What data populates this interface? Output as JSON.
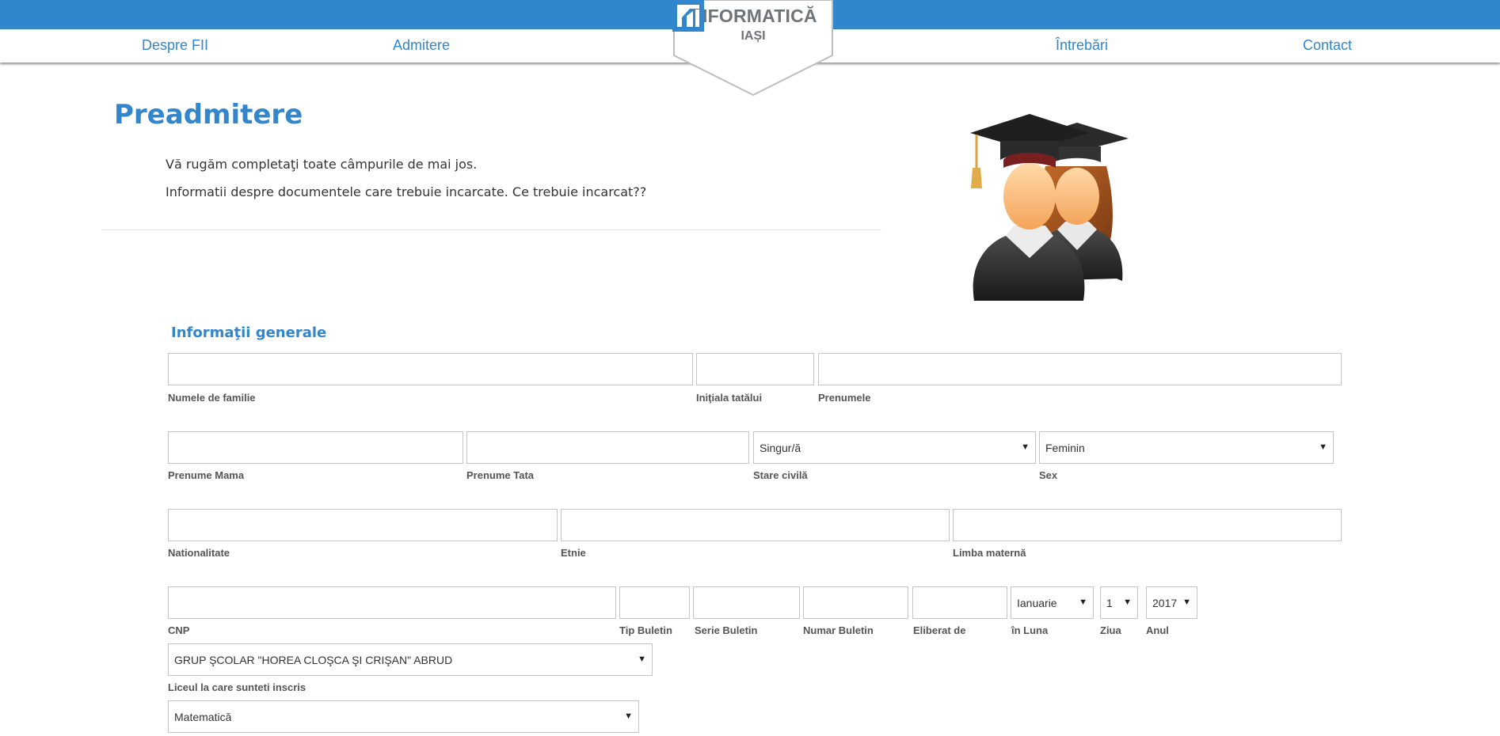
{
  "nav": {
    "items": [
      "Despre FII",
      "Admitere",
      "Întrebări",
      "Contact"
    ]
  },
  "logo": {
    "title": "INFORMATICĂ",
    "subtitle": "IAȘI"
  },
  "page": {
    "title": "Preadmitere",
    "intro_line1": "Vă rugăm completaţi toate câmpurile de mai jos.",
    "intro_line2": "Informatii despre documentele care trebuie incarcate. Ce trebuie incarcat??"
  },
  "form": {
    "section_title": "Informaţii generale",
    "labels": {
      "last_name": "Numele de familie",
      "father_initial": "Iniţiala tatălui",
      "first_name": "Prenumele",
      "mother_name": "Prenume Mama",
      "father_name": "Prenume Tata",
      "marital_status": "Stare civilă",
      "sex": "Sex",
      "nationality": "Nationalitate",
      "ethnicity": "Etnie",
      "mother_tongue": "Limba maternă",
      "cnp": "CNP",
      "id_type": "Tip Buletin",
      "id_series": "Serie Buletin",
      "id_number": "Numar Buletin",
      "issued_by": "Eliberat de",
      "month": "în Luna",
      "day": "Ziua",
      "year": "Anul",
      "high_school": "Liceul la care sunteti inscris"
    },
    "values": {
      "marital_status": "Singur/ă",
      "sex": "Feminin",
      "month": "Ianuarie",
      "day": "1",
      "year": "2017",
      "high_school": "GRUP ŞCOLAR \"HOREA CLOŞCA ŞI CRIŞAN\" ABRUD",
      "profile": "Matematică"
    }
  },
  "colors": {
    "brand": "#3286cc",
    "logo_gray": "#6f7478"
  },
  "icons": [
    "informatica-logo-icon",
    "graduates-icon",
    "chevron-down-icon"
  ]
}
